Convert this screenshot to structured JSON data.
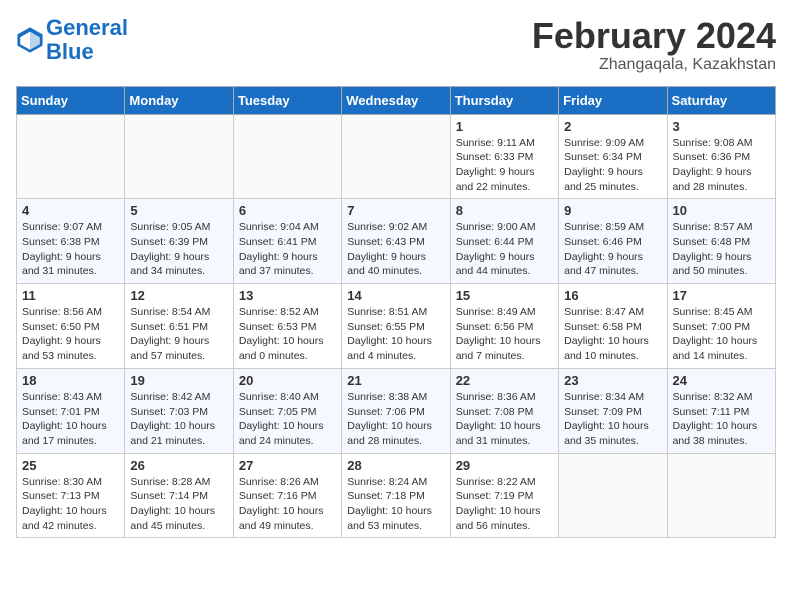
{
  "header": {
    "logo_line1": "General",
    "logo_line2": "Blue",
    "month": "February 2024",
    "location": "Zhangaqala, Kazakhstan"
  },
  "days_of_week": [
    "Sunday",
    "Monday",
    "Tuesday",
    "Wednesday",
    "Thursday",
    "Friday",
    "Saturday"
  ],
  "weeks": [
    [
      {
        "day": null
      },
      {
        "day": null
      },
      {
        "day": null
      },
      {
        "day": null
      },
      {
        "day": 1,
        "sunrise": "9:11 AM",
        "sunset": "6:33 PM",
        "daylight": "9 hours and 22 minutes."
      },
      {
        "day": 2,
        "sunrise": "9:09 AM",
        "sunset": "6:34 PM",
        "daylight": "9 hours and 25 minutes."
      },
      {
        "day": 3,
        "sunrise": "9:08 AM",
        "sunset": "6:36 PM",
        "daylight": "9 hours and 28 minutes."
      }
    ],
    [
      {
        "day": 4,
        "sunrise": "9:07 AM",
        "sunset": "6:38 PM",
        "daylight": "9 hours and 31 minutes."
      },
      {
        "day": 5,
        "sunrise": "9:05 AM",
        "sunset": "6:39 PM",
        "daylight": "9 hours and 34 minutes."
      },
      {
        "day": 6,
        "sunrise": "9:04 AM",
        "sunset": "6:41 PM",
        "daylight": "9 hours and 37 minutes."
      },
      {
        "day": 7,
        "sunrise": "9:02 AM",
        "sunset": "6:43 PM",
        "daylight": "9 hours and 40 minutes."
      },
      {
        "day": 8,
        "sunrise": "9:00 AM",
        "sunset": "6:44 PM",
        "daylight": "9 hours and 44 minutes."
      },
      {
        "day": 9,
        "sunrise": "8:59 AM",
        "sunset": "6:46 PM",
        "daylight": "9 hours and 47 minutes."
      },
      {
        "day": 10,
        "sunrise": "8:57 AM",
        "sunset": "6:48 PM",
        "daylight": "9 hours and 50 minutes."
      }
    ],
    [
      {
        "day": 11,
        "sunrise": "8:56 AM",
        "sunset": "6:50 PM",
        "daylight": "9 hours and 53 minutes."
      },
      {
        "day": 12,
        "sunrise": "8:54 AM",
        "sunset": "6:51 PM",
        "daylight": "9 hours and 57 minutes."
      },
      {
        "day": 13,
        "sunrise": "8:52 AM",
        "sunset": "6:53 PM",
        "daylight": "10 hours and 0 minutes."
      },
      {
        "day": 14,
        "sunrise": "8:51 AM",
        "sunset": "6:55 PM",
        "daylight": "10 hours and 4 minutes."
      },
      {
        "day": 15,
        "sunrise": "8:49 AM",
        "sunset": "6:56 PM",
        "daylight": "10 hours and 7 minutes."
      },
      {
        "day": 16,
        "sunrise": "8:47 AM",
        "sunset": "6:58 PM",
        "daylight": "10 hours and 10 minutes."
      },
      {
        "day": 17,
        "sunrise": "8:45 AM",
        "sunset": "7:00 PM",
        "daylight": "10 hours and 14 minutes."
      }
    ],
    [
      {
        "day": 18,
        "sunrise": "8:43 AM",
        "sunset": "7:01 PM",
        "daylight": "10 hours and 17 minutes."
      },
      {
        "day": 19,
        "sunrise": "8:42 AM",
        "sunset": "7:03 PM",
        "daylight": "10 hours and 21 minutes."
      },
      {
        "day": 20,
        "sunrise": "8:40 AM",
        "sunset": "7:05 PM",
        "daylight": "10 hours and 24 minutes."
      },
      {
        "day": 21,
        "sunrise": "8:38 AM",
        "sunset": "7:06 PM",
        "daylight": "10 hours and 28 minutes."
      },
      {
        "day": 22,
        "sunrise": "8:36 AM",
        "sunset": "7:08 PM",
        "daylight": "10 hours and 31 minutes."
      },
      {
        "day": 23,
        "sunrise": "8:34 AM",
        "sunset": "7:09 PM",
        "daylight": "10 hours and 35 minutes."
      },
      {
        "day": 24,
        "sunrise": "8:32 AM",
        "sunset": "7:11 PM",
        "daylight": "10 hours and 38 minutes."
      }
    ],
    [
      {
        "day": 25,
        "sunrise": "8:30 AM",
        "sunset": "7:13 PM",
        "daylight": "10 hours and 42 minutes."
      },
      {
        "day": 26,
        "sunrise": "8:28 AM",
        "sunset": "7:14 PM",
        "daylight": "10 hours and 45 minutes."
      },
      {
        "day": 27,
        "sunrise": "8:26 AM",
        "sunset": "7:16 PM",
        "daylight": "10 hours and 49 minutes."
      },
      {
        "day": 28,
        "sunrise": "8:24 AM",
        "sunset": "7:18 PM",
        "daylight": "10 hours and 53 minutes."
      },
      {
        "day": 29,
        "sunrise": "8:22 AM",
        "sunset": "7:19 PM",
        "daylight": "10 hours and 56 minutes."
      },
      {
        "day": null
      },
      {
        "day": null
      }
    ]
  ]
}
